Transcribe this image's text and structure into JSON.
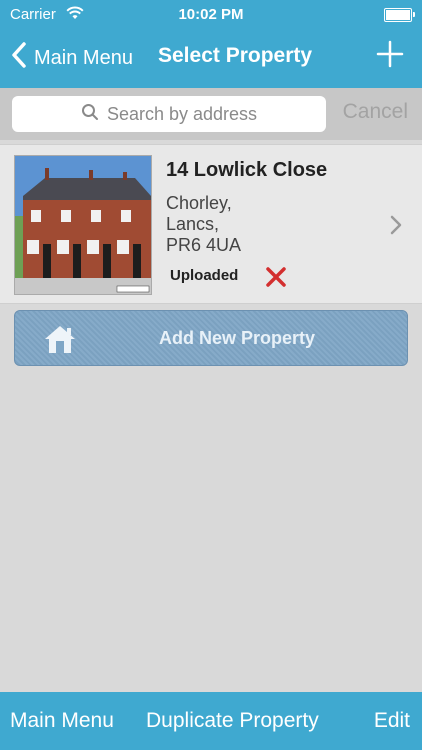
{
  "status_bar": {
    "carrier": "Carrier",
    "time": "10:02 PM"
  },
  "nav": {
    "back_label": "Main Menu",
    "title": "Select Property"
  },
  "search": {
    "placeholder": "Search by address",
    "cancel_label": "Cancel"
  },
  "property": {
    "title": "14 Lowlick Close",
    "address_lines": [
      "Chorley,",
      "Lancs,",
      "PR6 4UA"
    ],
    "status": "Uploaded"
  },
  "add_button": {
    "label": "Add New Property"
  },
  "toolbar": {
    "left": "Main Menu",
    "center": "Duplicate Property",
    "right": "Edit"
  },
  "colors": {
    "accent": "#3fa9d0",
    "delete": "#d32f2f",
    "add_button": "#7fa6c6"
  },
  "icons": {
    "wifi": "wifi-icon",
    "battery": "battery-icon",
    "back": "chevron-left-icon",
    "add": "plus-icon",
    "search": "search-icon",
    "delete": "close-x-icon",
    "disclosure": "chevron-right-icon",
    "house": "house-icon"
  }
}
